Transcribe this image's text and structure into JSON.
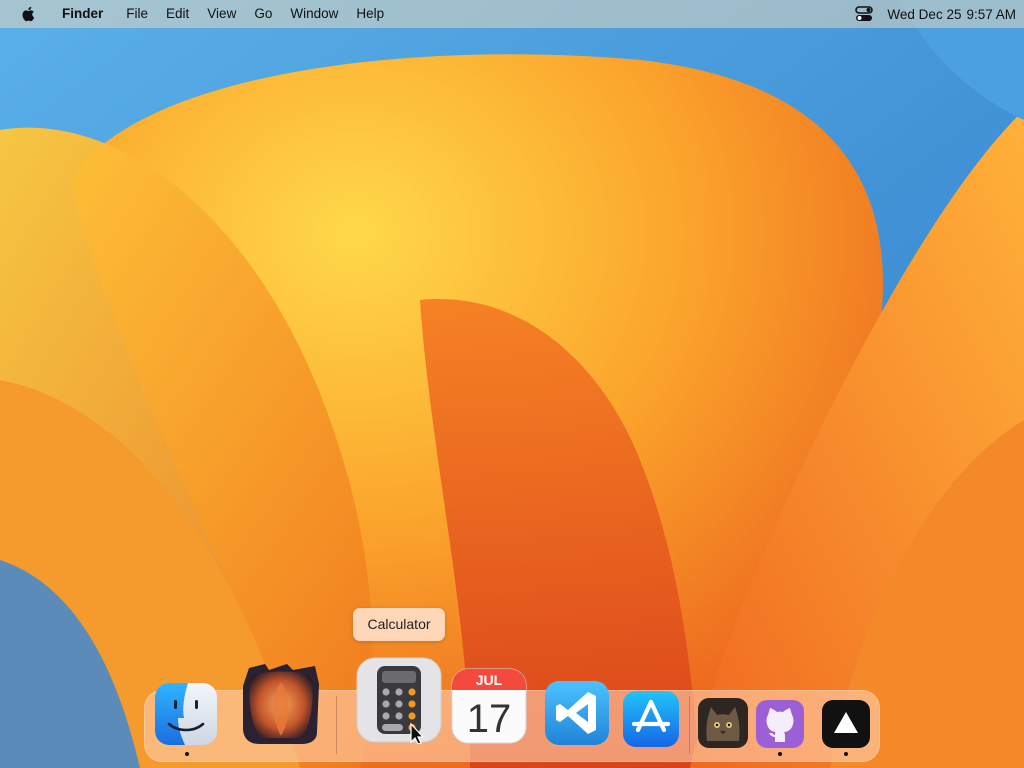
{
  "menubar": {
    "apple": "apple-logo-icon",
    "app_name": "Finder",
    "menus": [
      "File",
      "Edit",
      "View",
      "Go",
      "Window",
      "Help"
    ],
    "control_center": "control-center-icon",
    "date": "Wed Dec 25",
    "time": "9:57 AM"
  },
  "tooltip": {
    "text": "Calculator"
  },
  "dock": {
    "items": [
      {
        "name": "Finder",
        "icon": "finder-icon",
        "running": true
      },
      {
        "name": "Sequoia wallpaper app",
        "icon": "wallpaper-app-icon",
        "running": false
      },
      {
        "name": "Calculator",
        "icon": "calculator-icon",
        "running": false,
        "hovered": true
      },
      {
        "name": "Calendar",
        "icon": "calendar-icon",
        "running": false,
        "month": "JUL",
        "day": "17"
      },
      {
        "name": "Visual Studio Code",
        "icon": "vscode-icon",
        "running": false
      },
      {
        "name": "App Store",
        "icon": "app-store-icon",
        "running": false
      },
      {
        "name": "Cat photo",
        "icon": "cat-photo-icon",
        "running": false
      },
      {
        "name": "GitHub Desktop",
        "icon": "github-icon",
        "running": true
      },
      {
        "name": "Vercel",
        "icon": "vercel-icon",
        "running": true
      }
    ]
  },
  "colors": {
    "wallpaper_orange": "#f5a623",
    "wallpaper_blue": "#3a8fd8",
    "dock_bg": "#ffcdaa",
    "calendar_red": "#f24b3e"
  }
}
